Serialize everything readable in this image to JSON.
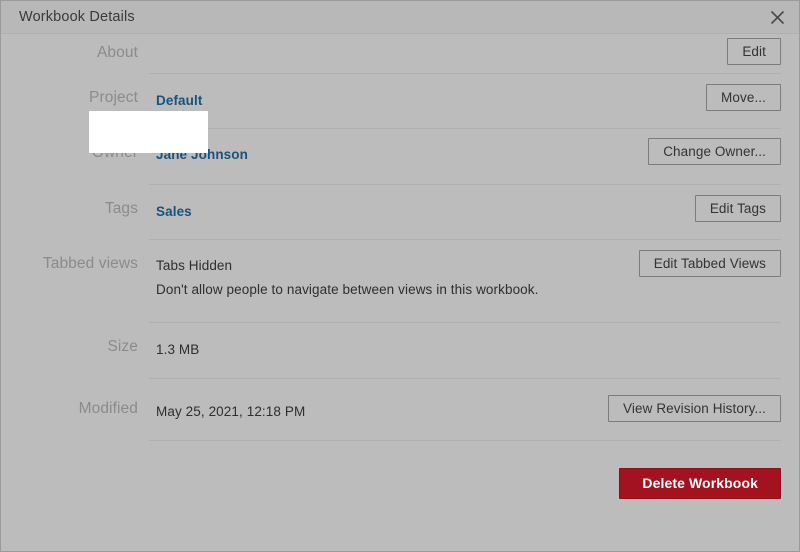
{
  "window": {
    "title": "Workbook Details",
    "close_icon": "close-icon"
  },
  "colors": {
    "background": "#bcbcbc",
    "titlebar": "#b8b8b8",
    "label": "#8b8b8b",
    "link": "#17537f",
    "text": "#2e2e2e",
    "divider": "#b0b0b0",
    "button_border": "#7c7c7c",
    "danger": "#a3121f",
    "highlight": "#ffffff"
  },
  "rows": {
    "about": {
      "label": "About",
      "button": "Edit"
    },
    "project": {
      "label": "Project",
      "value": "Default",
      "button": "Move..."
    },
    "owner": {
      "label": "Owner",
      "value": "Jane Johnson",
      "button": "Change Owner..."
    },
    "tags": {
      "label": "Tags",
      "value": "Sales",
      "button": "Edit Tags",
      "highlighted": true
    },
    "tabbed_views": {
      "label": "Tabbed views",
      "value": "Tabs Hidden",
      "description": "Don't allow people to navigate between views in this workbook.",
      "button": "Edit Tabbed Views"
    },
    "size": {
      "label": "Size",
      "value": "1.3 MB"
    },
    "modified": {
      "label": "Modified",
      "value": "May 25, 2021, 12:18 PM",
      "button": "View Revision History..."
    },
    "delete": {
      "button": "Delete Workbook"
    }
  }
}
